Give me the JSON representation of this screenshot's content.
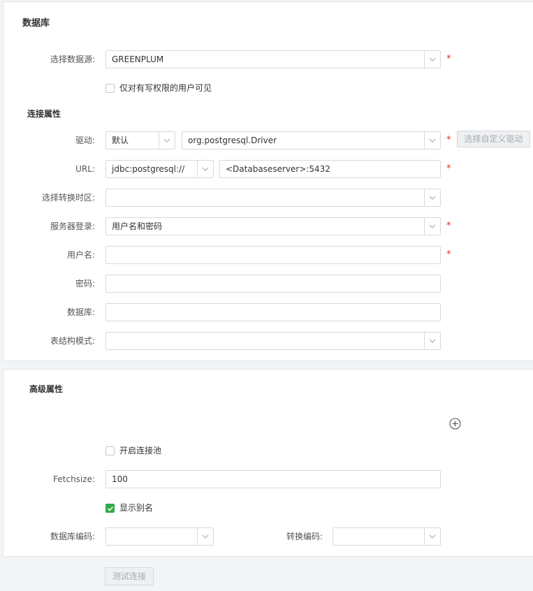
{
  "database_section": {
    "title": "数据库",
    "datasource": {
      "label": "选择数据源:",
      "value": "GREENPLUM",
      "required": "*"
    },
    "write_only_checkbox": {
      "label": "仅对有写权限的用户可见",
      "checked": false
    },
    "connection_title": "连接属性",
    "driver": {
      "label": "驱动:",
      "mode_value": "默认",
      "class_value": "org.postgresql.Driver",
      "required": "*",
      "custom_button": "选择自定义驱动"
    },
    "url": {
      "label": "URL:",
      "prefix_value": "jdbc:postgresql://",
      "host_value": "<Databaseserver>:5432",
      "required": "*"
    },
    "timezone": {
      "label": "选择转换时区:",
      "value": ""
    },
    "server_login": {
      "label": "服务器登录:",
      "value": "用户名和密码",
      "required": "*"
    },
    "username": {
      "label": "用户名:",
      "value": "",
      "required": "*"
    },
    "password": {
      "label": "密码:",
      "value": ""
    },
    "database": {
      "label": "数据库:",
      "value": ""
    },
    "schema": {
      "label": "表结构模式:",
      "value": ""
    }
  },
  "advanced_section": {
    "title": "高级属性",
    "connection_pool": {
      "label": "开启连接池",
      "checked": false
    },
    "fetchsize": {
      "label": "Fetchsize:",
      "value": "100"
    },
    "show_alias": {
      "label": "显示别名",
      "checked": true
    },
    "db_encoding": {
      "label": "数据库编码:",
      "value": ""
    },
    "convert_encoding": {
      "label": "转换编码:",
      "value": ""
    }
  },
  "test_button": "测试连接",
  "colors": {
    "required": "#e0302b",
    "check_green": "#2faa4a",
    "border": "#d7d9dc"
  },
  "icons": {
    "dropdown": "chevron-down-icon",
    "add": "plus-circle-icon",
    "check": "check-icon"
  }
}
